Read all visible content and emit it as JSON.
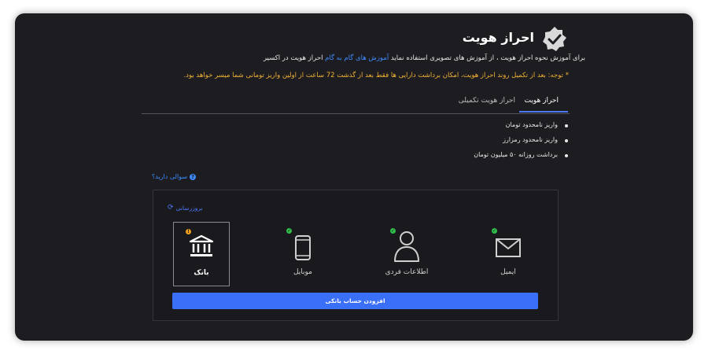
{
  "header": {
    "title": "احراز هویت",
    "icon": "verified-badge-icon"
  },
  "intro": {
    "before": "برای آموزش نحوه احراز هویت ، از آموزش های تصویری استفاده نماید ",
    "link": "آموزش های گام به گام",
    "after": " احراز هویت در اکسیر"
  },
  "notice": "* توجه: بعد از تکمیل روند احراز هویت، امکان برداشت دارایی ها فقط بعد از گذشت 72 ساعت از اولین واریز تومانی شما میسر خواهد بود.",
  "tabs": [
    {
      "label": "احراز هویت",
      "active": true
    },
    {
      "label": "احراز هویت تکمیلی",
      "active": false
    }
  ],
  "benefits": [
    "واریز نامحدود تومان",
    "واریز نامحدود رمزارز",
    "برداشت روزانه ۵۰ میلیون تومان"
  ],
  "question_link": "سوالی دارید؟",
  "refresh_label": "بروزرسانی",
  "steps": [
    {
      "label": "بانک",
      "status": "warning",
      "icon": "bank-icon",
      "selected": true
    },
    {
      "label": "موبایل",
      "status": "done",
      "icon": "mobile-icon",
      "selected": false
    },
    {
      "label": "اطلاعات فردی",
      "status": "done",
      "icon": "user-icon",
      "selected": false
    },
    {
      "label": "ایمیل",
      "status": "done",
      "icon": "email-icon",
      "selected": false
    }
  ],
  "add_button": "افزودن حساب بانکی",
  "colors": {
    "background": "#1d1d21",
    "accent": "#3a6ff7",
    "link": "#3d8bff",
    "notice": "#f2b233",
    "success": "#2fbf4a",
    "warning": "#f0a01a"
  }
}
